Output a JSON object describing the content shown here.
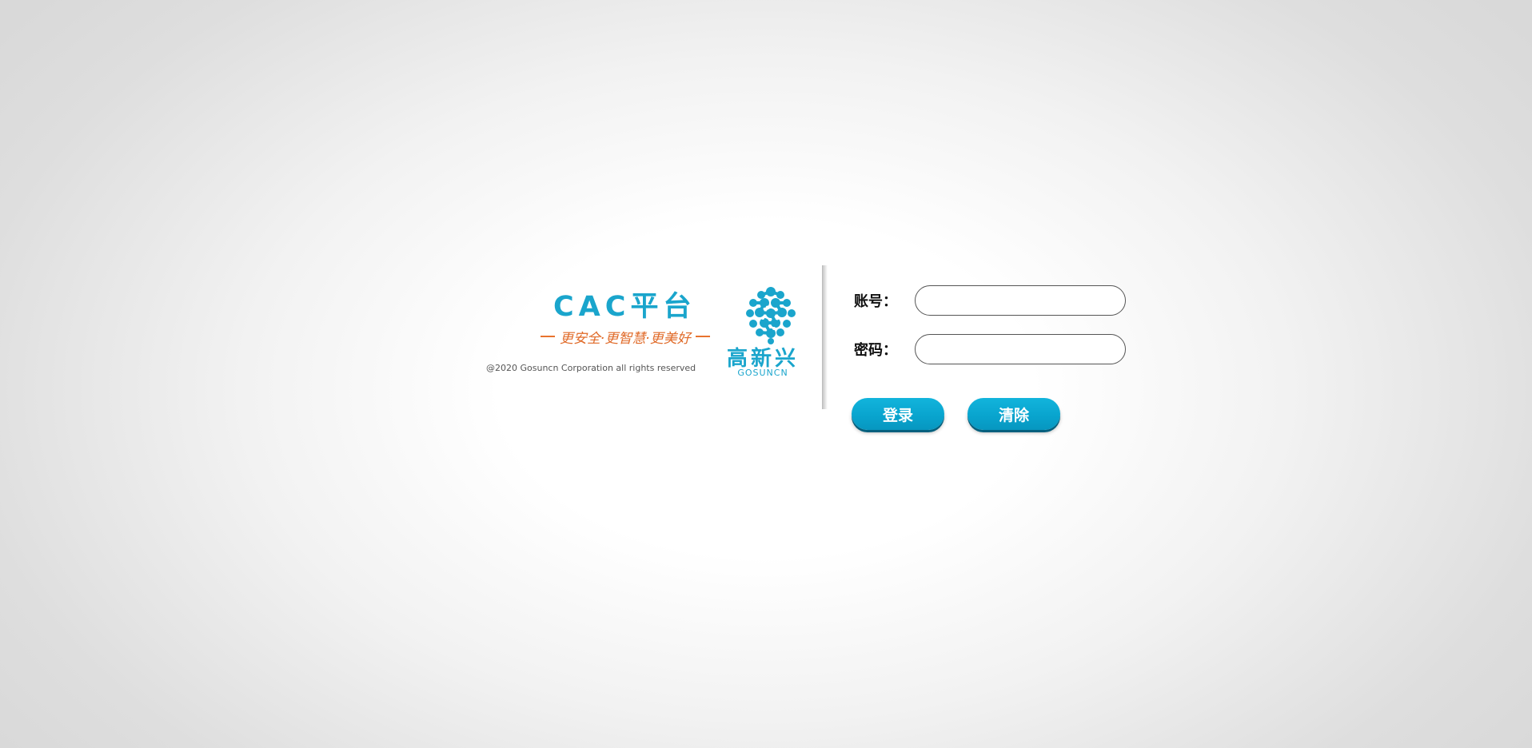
{
  "brand": {
    "platform_title": "CAC平台",
    "slogan": "更安全·更智慧·更美好",
    "copyright": "@2020 Gosuncn Corporation all rights reserved",
    "logo_cn": "高新兴",
    "logo_en": "GOSUNCN",
    "colors": {
      "brand_blue": "#1aa5cc",
      "slogan_orange": "#e8732e"
    }
  },
  "form": {
    "account_label": "账号：",
    "account_value": "",
    "password_label": "密码：",
    "password_value": ""
  },
  "buttons": {
    "login_label": "登录",
    "clear_label": "清除",
    "color": "#08a3cd"
  }
}
